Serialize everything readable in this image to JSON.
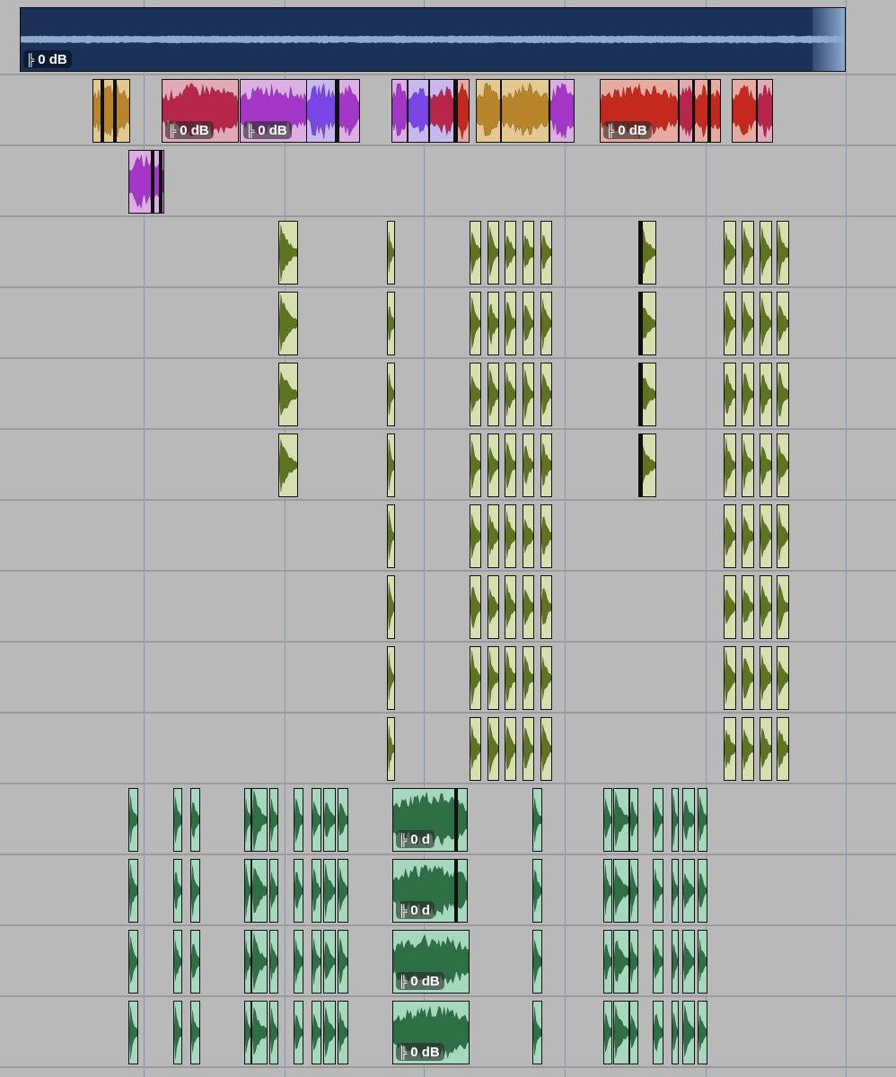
{
  "gain_label": "0 dB",
  "gain_icon": "fader-icon",
  "colors": {
    "background": "#b9b9b9",
    "gridline": "#8797ab",
    "master_fill": "#1b3158",
    "master_wave": "#8fa9cf",
    "drum_fill": "#d8deb0",
    "drum_wave": "#5e7420",
    "perc_fill": "#a6d8bd",
    "perc_wave": "#2e6f45",
    "orange_fill": "#e3c890",
    "orange_wave": "#b9852b",
    "crimson_fill": "#e2a9b9",
    "crimson_wave": "#b8254a",
    "magenta_fill": "#dcaee3",
    "magenta_wave": "#a436c8",
    "violet_fill": "#c9b8ee",
    "violet_wave": "#7a46e6",
    "red_fill": "#e7aaa0",
    "red_wave": "#c3291d"
  },
  "tracks": [
    {
      "name": "master-track",
      "gain_label": "0 dB"
    },
    {
      "name": "melody-track",
      "gain_labels": [
        "0 dB",
        "0 dB",
        "0 dB"
      ]
    },
    {
      "name": "fx-track"
    },
    {
      "name": "drum-track-1"
    },
    {
      "name": "drum-track-2"
    },
    {
      "name": "drum-track-3"
    },
    {
      "name": "drum-track-4"
    },
    {
      "name": "drum-track-5"
    },
    {
      "name": "drum-track-6"
    },
    {
      "name": "drum-track-7"
    },
    {
      "name": "drum-track-8"
    },
    {
      "name": "perc-track-1",
      "gain_label": "0 d"
    },
    {
      "name": "perc-track-2",
      "gain_label": "0 d"
    },
    {
      "name": "perc-track-3",
      "gain_label": "0 dB"
    },
    {
      "name": "perc-track-4",
      "gain_label": "0 dB"
    }
  ]
}
